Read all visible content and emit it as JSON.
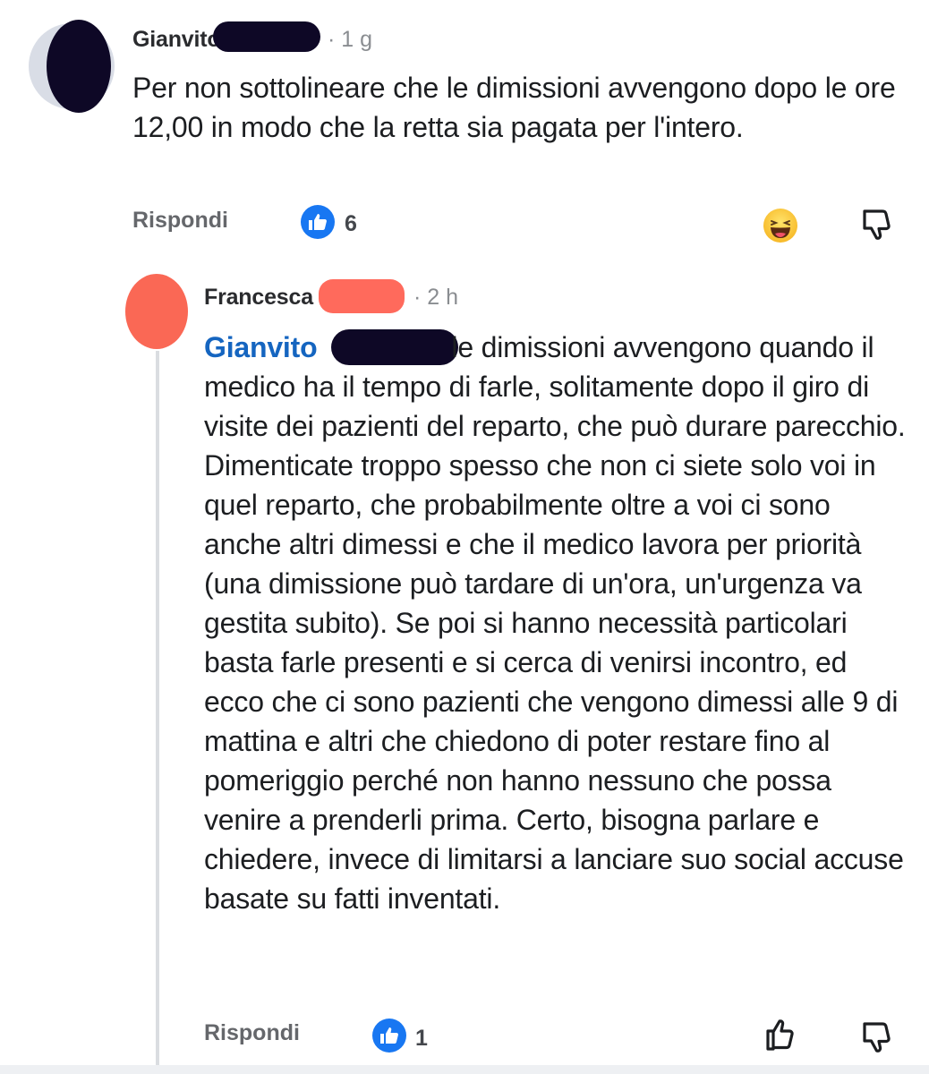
{
  "comment1": {
    "author_visible": "Gianvito",
    "time": "· 1 g",
    "text": "Per non sottolineare che le dimissioni avvengono dopo le ore 12,00 in modo che la retta sia pagata per l'intero.",
    "reply_label": "Rispondi",
    "like_count": "6",
    "reaction_icon": "laughing-face-icon",
    "dislike_icon": "thumbs-down-icon"
  },
  "comment2": {
    "author_visible": "Francesca",
    "time": "· 2 h",
    "mention": "Gianvito",
    "text": "le dimissioni avvengono quando il medico ha il tempo di farle, solitamente dopo il giro di visite dei pazienti del reparto, che può durare parecchio. Dimenticate troppo spesso che non ci siete solo voi in quel reparto, che probabilmente oltre a voi ci sono anche altri dimessi e che il medico lavora per priorità (una dimissione può tardare di un'ora, un'urgenza va gestita subito). Se poi si hanno necessità particolari basta farle presenti e si cerca di venirsi incontro, ed ecco che ci sono pazienti che vengono dimessi alle 9 di mattina e altri che chiedono di poter restare fino al pomeriggio perché non hanno nessuno che possa venire a prenderli prima. Certo, bisogna parlare e chiedere, invece di limitarsi a lanciare suo social accuse basate su fatti inventati.",
    "reply_label": "Rispondi",
    "like_count": "1",
    "like_icon": "thumbs-up-icon",
    "dislike_icon": "thumbs-down-icon"
  },
  "colors": {
    "like_blue": "#1877f2",
    "mention_blue": "#1565c0",
    "redaction_dark": "#0e0826",
    "redaction_red": "#ff6a5c"
  }
}
